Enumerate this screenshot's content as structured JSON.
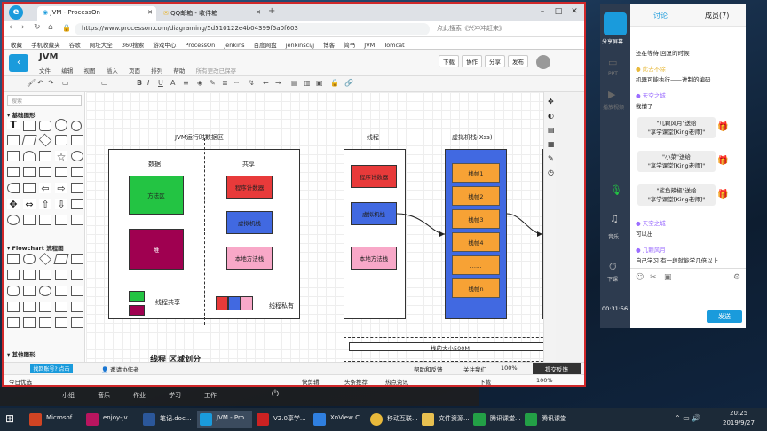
{
  "browser": {
    "tabs": [
      {
        "label": "JVM - ProcessOn"
      },
      {
        "label": "QQ邮箱 - 收件箱"
      }
    ],
    "new_tab": "+",
    "url": "https://www.processon.com/diagraming/5d510122e4b04399f5a0f603",
    "search_hint": "点此搜索《兴冲冲赶来》",
    "bookmarks": [
      "收藏",
      "手机收藏夹",
      "谷歌",
      "网址大全",
      "360搜索",
      "游戏中心",
      "ProcessOn",
      "Jenkins",
      "百度网盘",
      "jenkinsci/j",
      "博客",
      "简书",
      "JVM",
      "Tomcat"
    ]
  },
  "app": {
    "title": "JVM",
    "menu": [
      "文件",
      "编辑",
      "视图",
      "插入",
      "页面",
      "排列",
      "帮助"
    ],
    "save_status": "所有更改已保存",
    "header_buttons": [
      "下载",
      "协作",
      "分享",
      "发布"
    ],
    "search_placeholder": "搜索",
    "panel_sections": [
      "基础图形",
      "Flowchart 流程图",
      "其他图形"
    ]
  },
  "diagram": {
    "region_title": "JVM运行时数据区",
    "heap_label": "数据",
    "shared_label": "共享",
    "method_area": "方法区",
    "heap": "堆",
    "thread_private": "线程共享",
    "pc": "程序计数器",
    "vm_stack": "虚拟机栈",
    "native_stack": "本地方法栈",
    "thread_private_label": "线程私有",
    "thread_label": "线程",
    "thread_pc": "程序计数器",
    "thread_vm": "虚拟机栈",
    "thread_native": "本地方法栈",
    "stack_title": "虚拟机栈(Xss)",
    "frames": [
      "栈帧1",
      "栈帧2",
      "栈帧3",
      "栈帧4",
      "……",
      "栈帧n"
    ],
    "bottom_label": "栈的大小500M",
    "bottom_title": "线程 区域划分"
  },
  "status": {
    "invite": "邀请协作者",
    "help_text": "帮助和反馈",
    "follow": "关注我们",
    "zoom": "100%",
    "send_label": "提交反馈",
    "qq_label": "找回账号? 点击"
  },
  "download_bar": {
    "items": [
      "今日优选",
      "快剪辑",
      "头条推荐",
      "热点资讯",
      "下载",
      "100%"
    ]
  },
  "dark_bar": {
    "items": [
      "小组",
      "音乐",
      "作业",
      "学习",
      "工作"
    ]
  },
  "chat": {
    "tabs": [
      "讨论",
      "成员(7)"
    ],
    "messages": [
      {
        "user": "",
        "text": "还在等待 回复的时候"
      },
      {
        "user": "此去不除",
        "text": "机器可能执行——进制的编码"
      },
      {
        "user": "天空之城",
        "text": "我懂了"
      },
      {
        "user": "",
        "text": "\"几颗风月\"送给\n\"享学课堂[King老师]\""
      },
      {
        "user": "",
        "text": "\"小菜\"送给\n\"享学课堂[King老师]\""
      },
      {
        "user": "",
        "text": "\"鲨鱼辣椒\"送给\n\"享学课堂[King老师]\""
      },
      {
        "user": "天空之城",
        "text": "可以出"
      },
      {
        "user": "几颗风月",
        "text": "自己学习 有一段就能学几倍以上"
      }
    ],
    "send": "发送",
    "time": "00:31:56",
    "left_icons": [
      "分享屏幕",
      "PPT",
      "播放视频",
      "音乐",
      "下课"
    ]
  },
  "taskbar": {
    "items": [
      "Microsof...",
      "enjoy-jv...",
      "笔记.doc...",
      "JVM - Pro...",
      "V2.0享学...",
      "XnView C...",
      "移动互联...",
      "文件资源...",
      "腾讯课堂...",
      "腾讯课堂"
    ],
    "time": "20:25",
    "date": "2019/9/27"
  },
  "colors": {
    "accent": "#1a9bdc",
    "green": "#23c443",
    "purple": "#9f0050",
    "red": "#e83a3a",
    "blue": "#4169e1",
    "pink": "#f8a8c8",
    "orange": "#f7b53b",
    "frame_bg": "#f7a235"
  }
}
